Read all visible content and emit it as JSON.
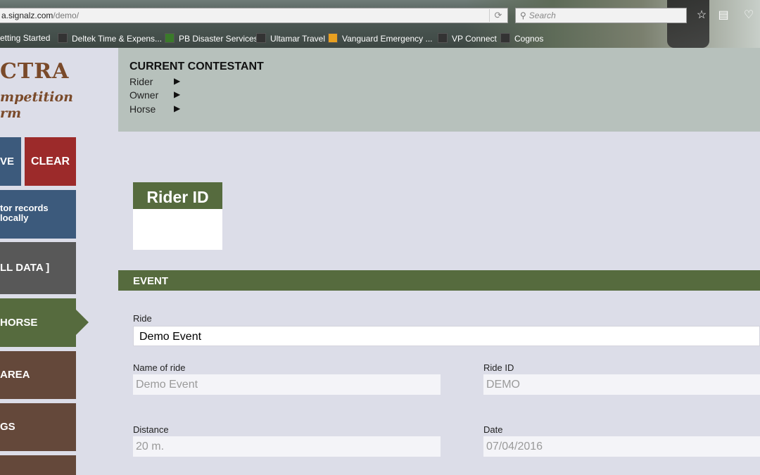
{
  "browser": {
    "url_host": "a.signalz.com",
    "url_path": "/demo/",
    "search_placeholder": "Search",
    "bookmarks": [
      "etting Started",
      "Deltek Time & Expens...",
      "PB Disaster Services",
      "Ultamar Travel",
      "Vanguard Emergency ...",
      "VP Connect",
      "Cognos"
    ]
  },
  "logo": {
    "line1": "CTRA",
    "line2": "mpetition",
    "line3": "rm"
  },
  "sidebar": {
    "save_label": "VE",
    "clear_label": "CLEAR",
    "local_line1": "tor records",
    "local_line2": "locally",
    "all_data_label": "LL DATA ]",
    "horse_label": "HORSE",
    "area_label": "AREA",
    "gs_label": "GS"
  },
  "contestant": {
    "title": "CURRENT CONTESTANT",
    "rows": [
      "Rider",
      "Owner",
      "Horse"
    ]
  },
  "rider_card": {
    "title": "Rider ID",
    "value": ""
  },
  "event": {
    "section_title": "EVENT",
    "ride_label": "Ride",
    "ride_value": "Demo Event",
    "name_label": "Name of ride",
    "name_value": "Demo Event",
    "rideid_label": "Ride ID",
    "rideid_value": "DEMO",
    "distance_label": "Distance",
    "distance_value": "20 m.",
    "date_label": "Date",
    "date_value": "07/04/2016"
  }
}
